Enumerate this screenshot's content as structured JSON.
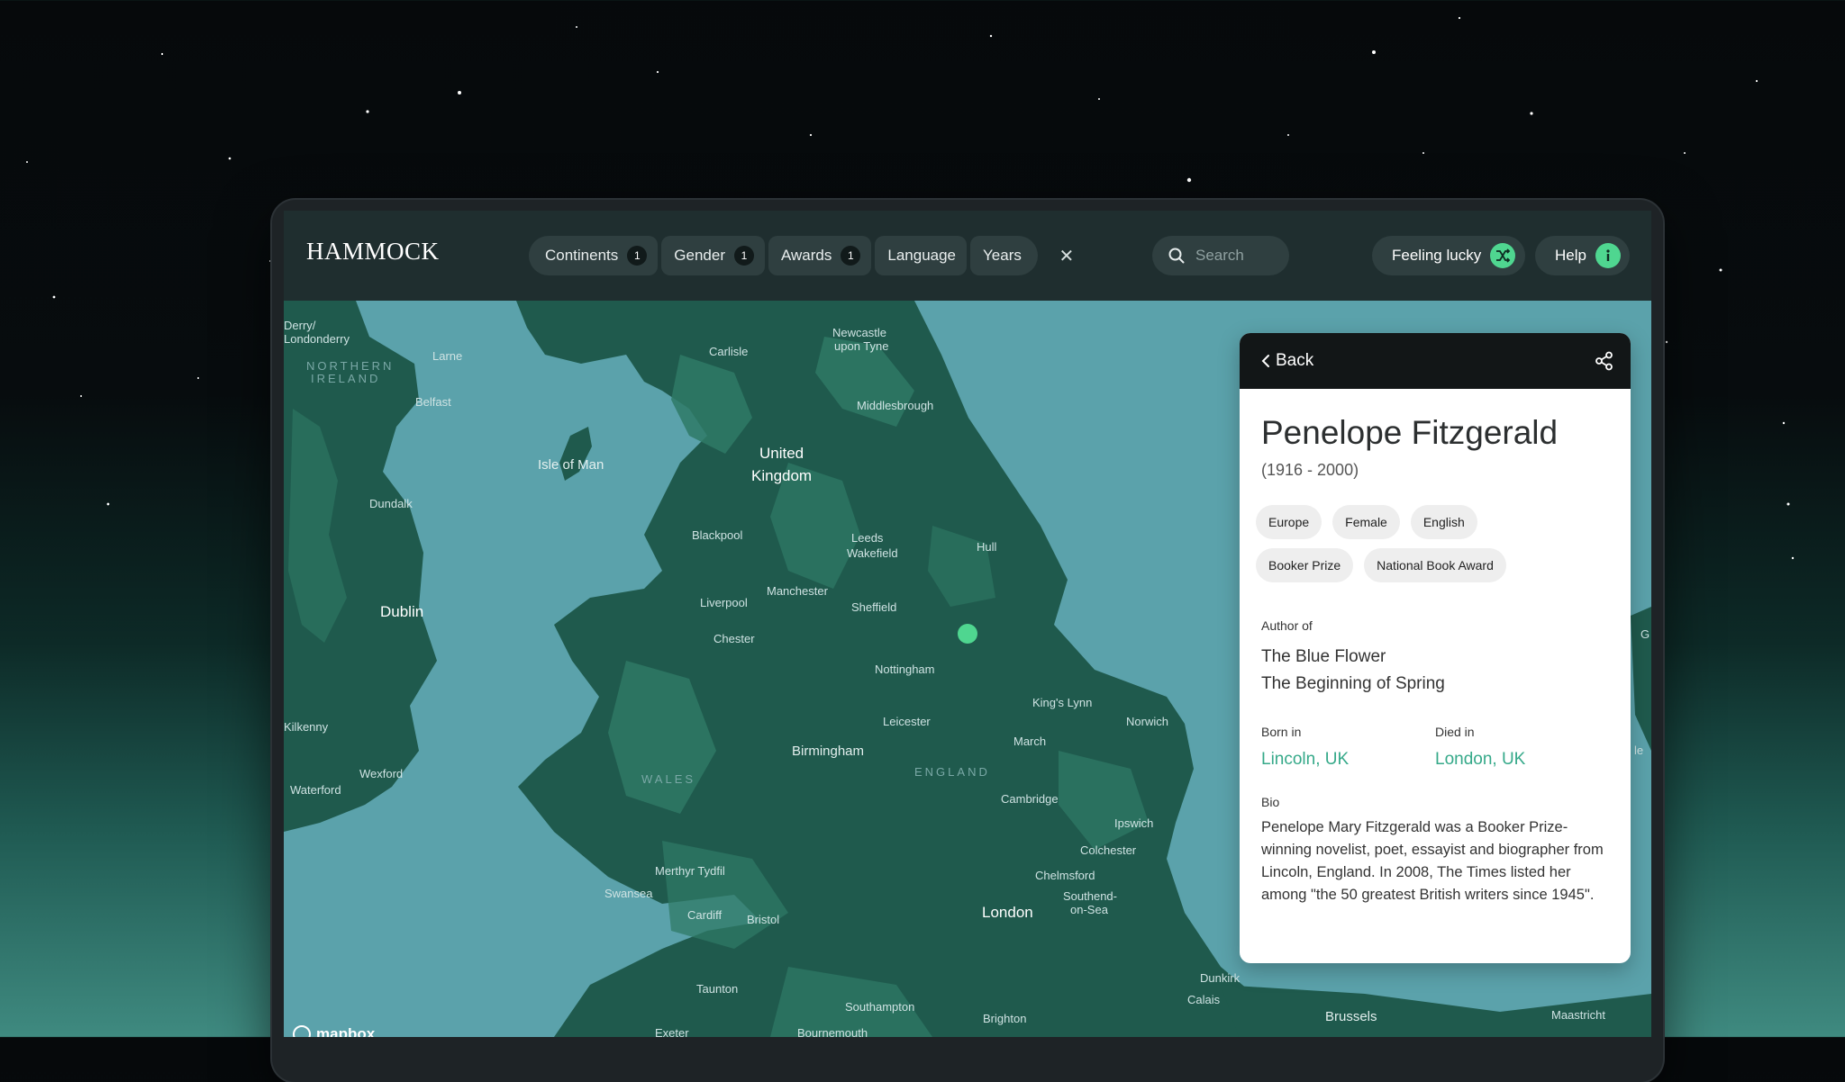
{
  "app": {
    "logo": "HAMMOCK"
  },
  "filters": [
    {
      "label": "Continents",
      "count": "1"
    },
    {
      "label": "Gender",
      "count": "1"
    },
    {
      "label": "Awards",
      "count": "1"
    },
    {
      "label": "Language"
    },
    {
      "label": "Years"
    }
  ],
  "search": {
    "placeholder": "Search"
  },
  "actions": {
    "lucky": "Feeling lucky",
    "help": "Help"
  },
  "map": {
    "labels": {
      "derry": "Derry/",
      "londonderry": "Londonderry",
      "larne": "Larne",
      "northern": "NORTHERN",
      "ireland": "IRELAND",
      "belfast": "Belfast",
      "carlisle": "Carlisle",
      "newcastle1": "Newcastle",
      "newcastle2": "upon Tyne",
      "middlesbrough": "Middlesbrough",
      "isleofman": "Isle of Man",
      "uk1": "United",
      "uk2": "Kingdom",
      "dundalk": "Dundalk",
      "blackpool": "Blackpool",
      "leeds": "Leeds",
      "wakefield": "Wakefield",
      "hull": "Hull",
      "dublin": "Dublin",
      "liverpool": "Liverpool",
      "manchester": "Manchester",
      "sheffield": "Sheffield",
      "chester": "Chester",
      "nottingham": "Nottingham",
      "kingslynn": "King's Lynn",
      "norwich": "Norwich",
      "kilkenny": "Kilkenny",
      "leicester": "Leicester",
      "march": "March",
      "birmingham": "Birmingham",
      "england": "ENGLAND",
      "wales": "WALES",
      "wexford": "Wexford",
      "waterford": "Waterford",
      "cambridge": "Cambridge",
      "ipswich": "Ipswich",
      "colchester": "Colchester",
      "merthyr": "Merthyr Tydfil",
      "chelmsford": "Chelmsford",
      "swansea": "Swansea",
      "southend1": "Southend-",
      "southend2": "on-Sea",
      "cardiff": "Cardiff",
      "bristol": "Bristol",
      "london": "London",
      "dunkirk": "Dunkirk",
      "taunton": "Taunton",
      "calais": "Calais",
      "southampton": "Southampton",
      "brighton": "Brighton",
      "brussels": "Brussels",
      "maastricht": "Maastricht",
      "exeter": "Exeter",
      "bournemouth": "Bournemouth",
      "edge_g": "G",
      "edge_le": "le",
      "attribution": "mapbox"
    }
  },
  "card": {
    "back": "Back",
    "name": "Penelope Fitzgerald",
    "years": "(1916 - 2000)",
    "tags": [
      "Europe",
      "Female",
      "English",
      "Booker Prize",
      "National Book Award"
    ],
    "author_of_label": "Author of",
    "works": [
      "The Blue Flower",
      "The Beginning of Spring"
    ],
    "born_label": "Born in",
    "born": "Lincoln, UK",
    "died_label": "Died in",
    "died": "London, UK",
    "bio_label": "Bio",
    "bio": "Penelope Mary Fitzgerald was a Booker Prize-winning novelist, poet, essayist and biographer from Lincoln, England. In 2008, The Times listed her among \"the 50 greatest British writers since 1945\"."
  },
  "colors": {
    "accent": "#4fd690",
    "link": "#35a989",
    "water": "#5ba2ab",
    "land": "#1f5a4d"
  }
}
